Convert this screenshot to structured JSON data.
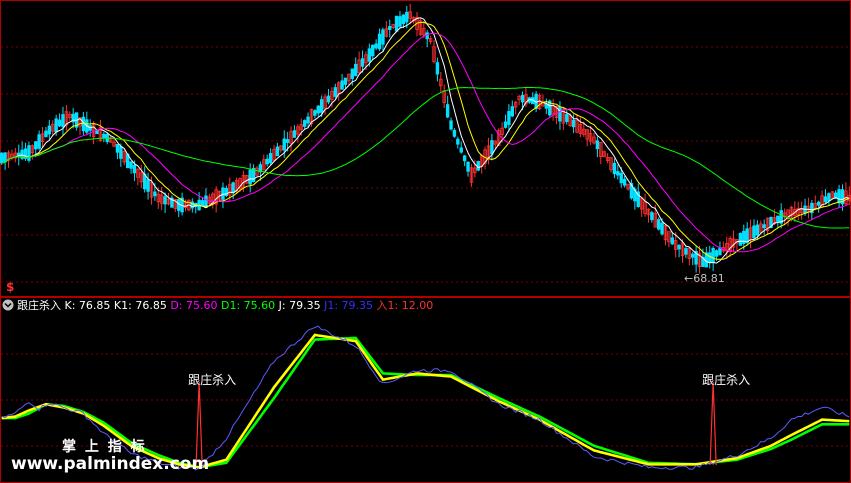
{
  "chart_data": [
    {
      "type": "candlestick",
      "min_price_label": "68.81",
      "marker_symbol": "$",
      "colors": {
        "up": "#ff3030",
        "down": "#00e0ff",
        "ma1": "#ffffff",
        "ma2": "#ffff00",
        "ma3": "#ff00ff",
        "ma4": "#00ff00"
      }
    },
    {
      "type": "line",
      "indicator_name": "跟庄杀入",
      "readouts": [
        {
          "label": "K:",
          "value": "76.85",
          "color": "#ffffff"
        },
        {
          "label": "K1:",
          "value": "76.85",
          "color": "#ffffff"
        },
        {
          "label": "D:",
          "value": "75.60",
          "color": "#ff00ff"
        },
        {
          "label": "D1:",
          "value": "75.60",
          "color": "#00ff00"
        },
        {
          "label": "J:",
          "value": "79.35",
          "color": "#ffffff"
        },
        {
          "label": "J1:",
          "value": "79.35",
          "color": "#3030ff"
        },
        {
          "label": "入1:",
          "value": "12.00",
          "color": "#ff3030"
        }
      ],
      "signal_label": "跟庄杀入",
      "signals_x": [
        58,
        209
      ],
      "x_count": 250,
      "ylim": [
        0,
        100
      ],
      "series": [
        {
          "key": "j",
          "color": "#5a5aff",
          "x": [
            0,
            4,
            8,
            11,
            14,
            18,
            24,
            30,
            38,
            46,
            52,
            58,
            66,
            80,
            92,
            104,
            112,
            122,
            132,
            146,
            158,
            174,
            190,
            204,
            216,
            226,
            232,
            241,
            249
          ],
          "y": [
            35,
            38,
            46,
            41,
            45,
            42,
            38,
            25,
            12,
            6,
            3,
            2,
            22,
            72,
            95,
            82,
            57,
            66,
            66,
            44,
            34,
            10,
            3,
            3,
            11,
            22,
            34,
            42,
            36
          ]
        },
        {
          "key": "k",
          "color": "#ffff00",
          "x": [
            0,
            4,
            8,
            13,
            18,
            24,
            30,
            38,
            46,
            52,
            58,
            66,
            80,
            92,
            104,
            112,
            122,
            132,
            146,
            158,
            174,
            190,
            204,
            216,
            226,
            232,
            241,
            249
          ],
          "y": [
            35,
            36,
            40,
            44,
            42,
            38,
            30,
            17,
            9,
            5,
            3,
            8,
            55,
            89,
            85,
            60,
            64,
            62,
            46,
            34,
            14,
            5,
            5,
            9,
            17,
            24,
            34,
            33
          ]
        },
        {
          "key": "d",
          "color": "#00ff00",
          "x": [
            0,
            4,
            8,
            13,
            18,
            24,
            30,
            38,
            46,
            52,
            58,
            66,
            80,
            92,
            104,
            112,
            122,
            132,
            146,
            158,
            174,
            190,
            204,
            216,
            226,
            232,
            241,
            249
          ],
          "y": [
            35,
            35,
            38,
            44,
            43,
            39,
            32,
            19,
            11,
            6,
            3,
            6,
            48,
            86,
            87,
            64,
            63,
            63,
            48,
            36,
            17,
            6,
            5,
            8,
            15,
            21,
            31,
            31
          ]
        }
      ]
    }
  ],
  "watermark": {
    "title": "掌 上 指 标",
    "url": "www.palmindex.com"
  }
}
